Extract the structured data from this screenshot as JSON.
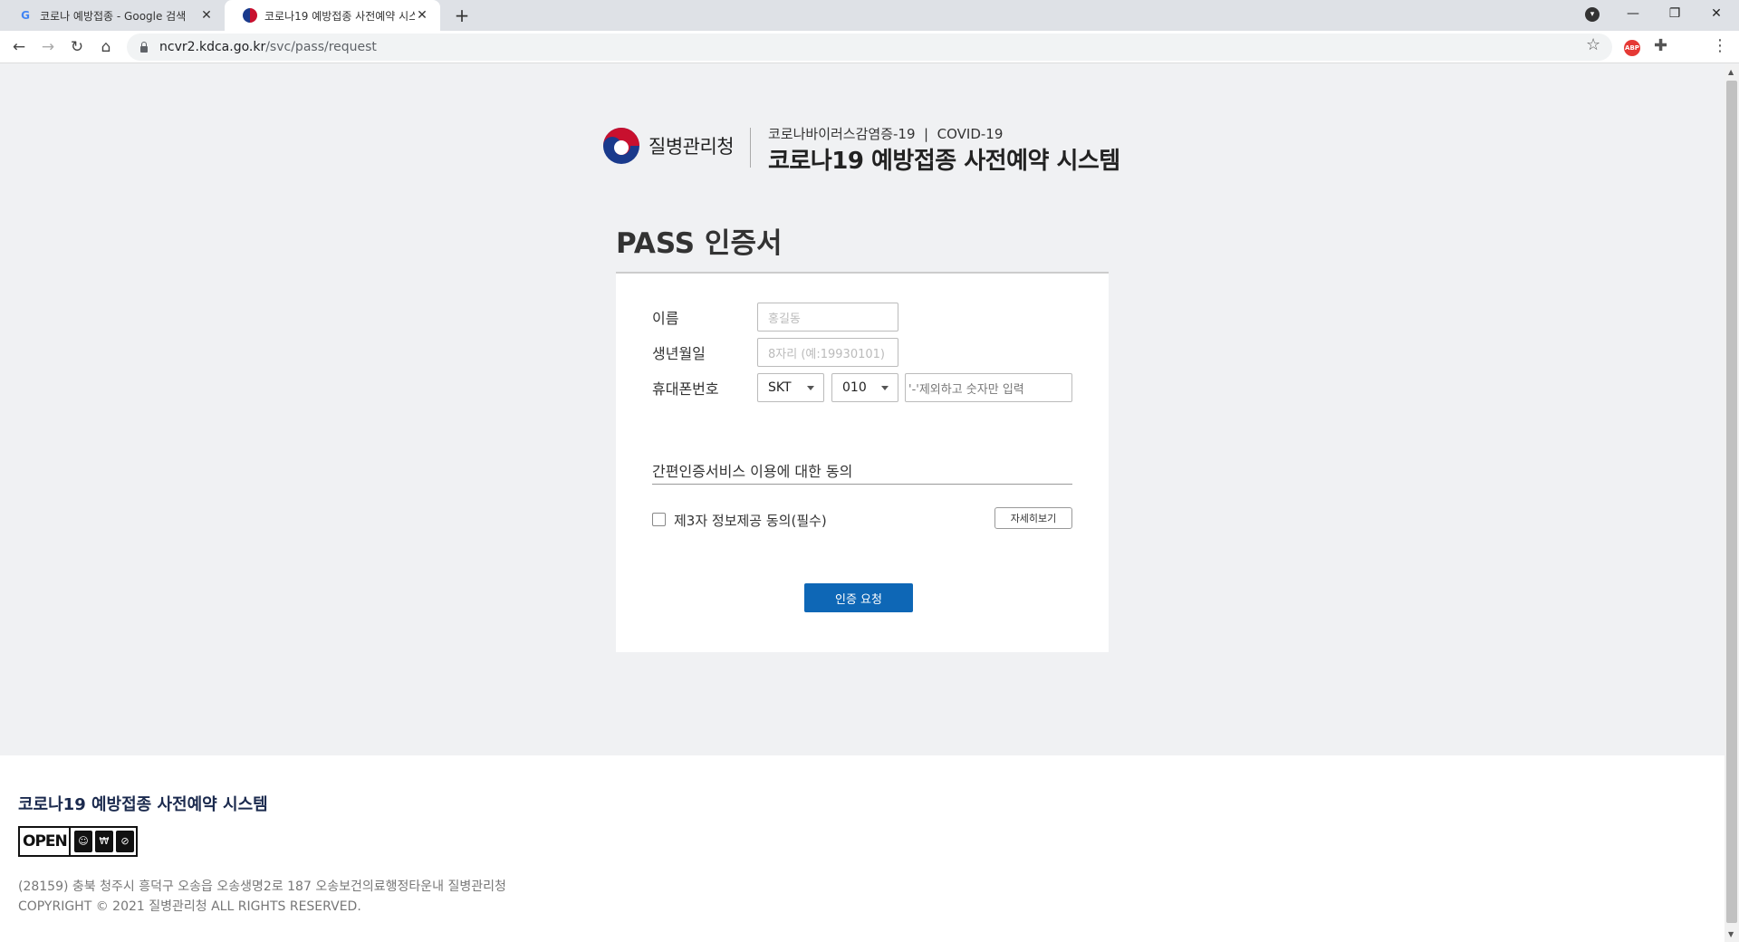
{
  "browser": {
    "tabs": [
      {
        "title": "코로나 예방접종 - Google 검색",
        "favicon": "google-icon",
        "active": false
      },
      {
        "title": "코로나19 예방접종 사전예약 시스템",
        "favicon": "kdca-emblem-icon",
        "active": true
      }
    ],
    "url_host": "ncvr2.kdca.go.kr",
    "url_path": "/svc/pass/request"
  },
  "header": {
    "org_name": "질병관리청",
    "subtitle": "코로나바이러스감염증-19  |  COVID-19",
    "title": "코로나19 예방접종 사전예약 시스템"
  },
  "page_title": "PASS 인증서",
  "form": {
    "name_label": "이름",
    "name_placeholder": "홍길동",
    "birth_label": "생년월일",
    "birth_placeholder": "8자리 (예:19930101)",
    "phone_label": "휴대폰번호",
    "carrier_value": "SKT",
    "prefix_value": "010",
    "phone_placeholder": "'-'제외하고 숫자만 입력",
    "agree_title": "간편인증서비스 이용에 대한 동의",
    "agree_check_label": "제3자 정보제공 동의(필수)",
    "detail_button": "자세히보기",
    "submit_button": "인증 요청"
  },
  "footer": {
    "title": "코로나19 예방접종 사전예약 시스템",
    "open_badge": "OPEN",
    "address": "(28159) 충북 청주시 흥덕구 오송읍 오송생명2로 187 오송보건의료행정타운내 질병관리청",
    "copyright": "COPYRIGHT © 2021 질병관리청 ALL RIGHTS RESERVED."
  },
  "colors": {
    "primary_button": "#0e67b6",
    "footer_title": "#1b2a4e",
    "page_bg": "#f0f1f3"
  }
}
